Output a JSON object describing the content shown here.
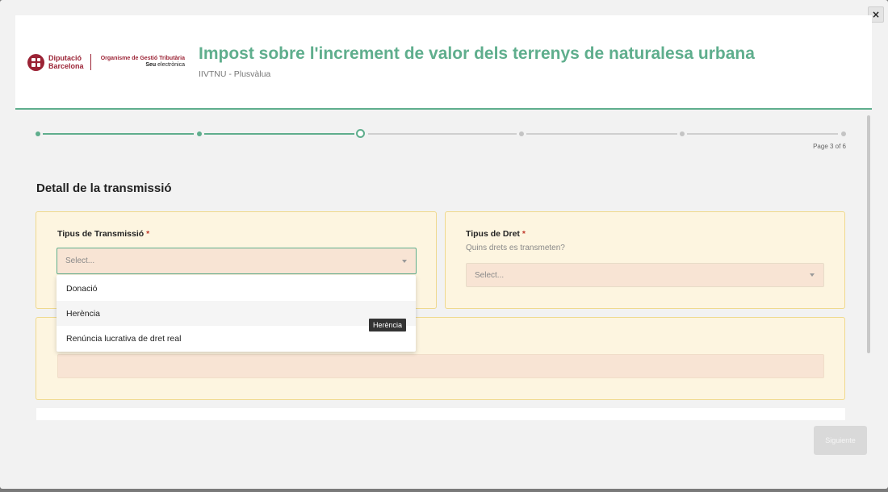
{
  "close_label": "×",
  "header": {
    "logo": {
      "org1_line1": "Diputació",
      "org1_line2": "Barcelona",
      "org2": "Organisme de Gestió Tributària",
      "seu_bold": "Seu",
      "seu_rest": "electrònica"
    },
    "title": "Impost sobre l'increment de valor dels terrenys de naturalesa urbana",
    "subtitle": "IIVTNU - Plusvàlua"
  },
  "stepper": {
    "total": 6,
    "current": 3,
    "page_label": "Page 3 of 6"
  },
  "section_title": "Detall de la transmissió",
  "fields": {
    "tipus_transmissio": {
      "label": "Tipus de Transmissió",
      "required_mark": "*",
      "placeholder": "Select...",
      "options": [
        "Donació",
        "Herència",
        "Renúncia lucrativa de dret real"
      ],
      "hovered_option": "Herència"
    },
    "tipus_dret": {
      "label": "Tipus de Dret",
      "required_mark": "*",
      "hint": "Quins drets es transmeten?",
      "placeholder": "Select..."
    }
  },
  "tooltip": "Herència",
  "next_button": "Siguiente",
  "colors": {
    "accent": "#5fae8d",
    "card_bg": "#fdf5e0",
    "input_bg": "#f8e4d4",
    "brand": "#9b2335"
  }
}
